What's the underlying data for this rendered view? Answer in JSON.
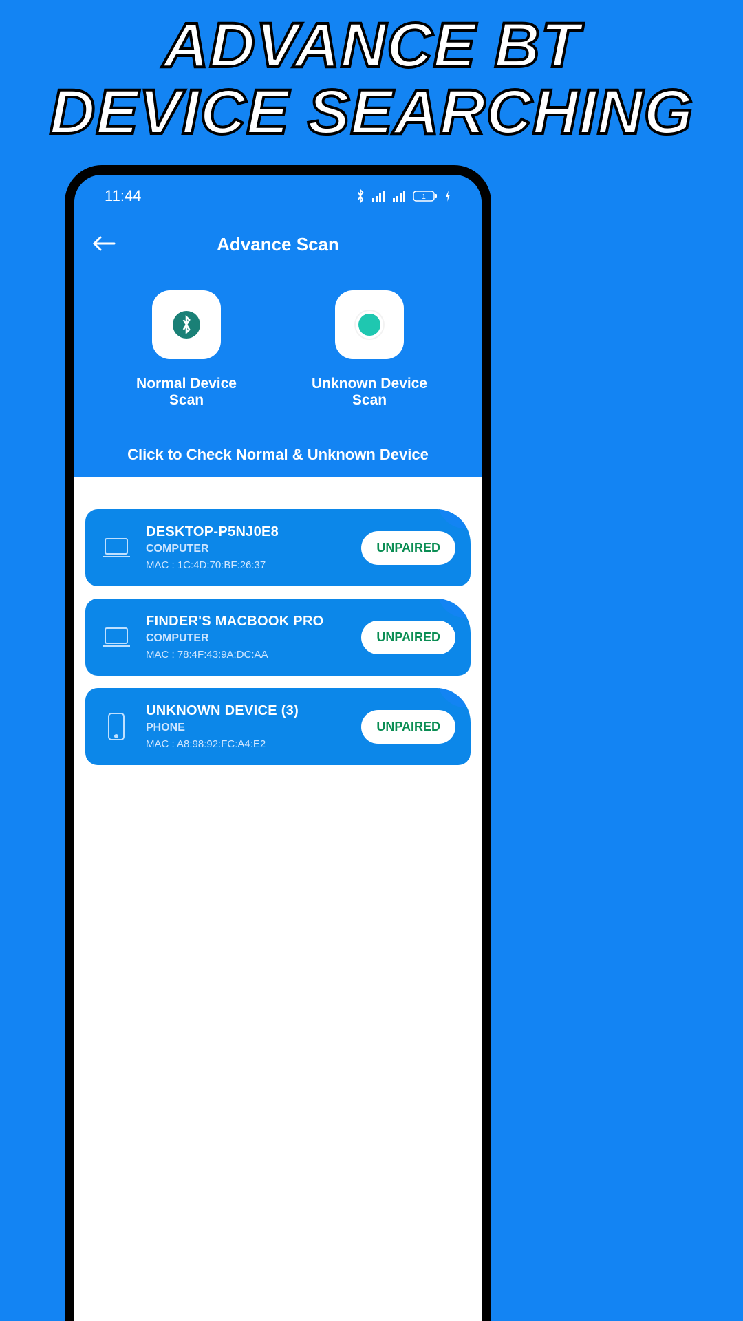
{
  "promo": {
    "line1": "ADVANCE BT",
    "line2": "DEVICE SEARCHING"
  },
  "statusbar": {
    "time": "11:44",
    "battery_label": "1"
  },
  "header": {
    "title": "Advance Scan"
  },
  "scan": {
    "normal_label": "Normal Device Scan",
    "unknown_label": "Unknown Device Scan"
  },
  "instruction": "Click to Check Normal & Unknown Device",
  "devices": [
    {
      "name": "DESKTOP-P5NJ0E8",
      "type": "COMPUTER",
      "mac": "MAC : 1C:4D:70:BF:26:37",
      "status": "UNPAIRED",
      "icon": "laptop"
    },
    {
      "name": "FINDER'S MACBOOK PRO",
      "type": "COMPUTER",
      "mac": "MAC : 78:4F:43:9A:DC:AA",
      "status": "UNPAIRED",
      "icon": "laptop"
    },
    {
      "name": "UNKNOWN DEVICE (3)",
      "type": "PHONE",
      "mac": "MAC : A8:98:92:FC:A4:E2",
      "status": "UNPAIRED",
      "icon": "phone"
    }
  ]
}
